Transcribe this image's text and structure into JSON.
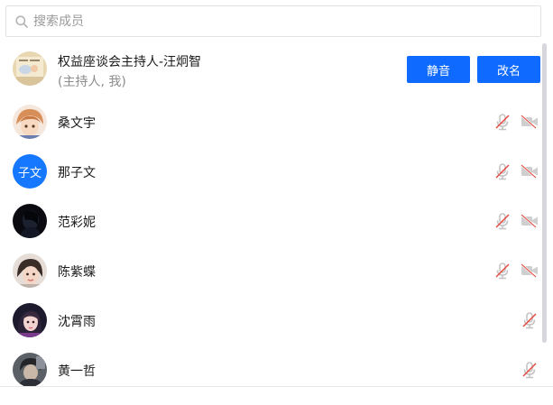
{
  "search": {
    "placeholder": "搜索成员"
  },
  "host": {
    "name": "权益座谈会主持人-汪炯智",
    "role": "(主持人, 我)",
    "mute_label": "静音",
    "rename_label": "改名"
  },
  "members": [
    {
      "name": "桑文宇",
      "mic": "muted",
      "camera": "off"
    },
    {
      "name": "那子文",
      "avatar_text": "子文",
      "mic": "muted",
      "camera": "off"
    },
    {
      "name": "范彩妮",
      "mic": "muted",
      "camera": "off"
    },
    {
      "name": "陈紫蝶",
      "mic": "muted",
      "camera": "off"
    },
    {
      "name": "沈霄雨",
      "mic": "muted"
    },
    {
      "name": "黄一哲",
      "mic": "muted"
    }
  ],
  "colors": {
    "accent": "#0f6bff",
    "muted_slash": "#e8453c",
    "icon_gray": "#c4c4c4"
  }
}
